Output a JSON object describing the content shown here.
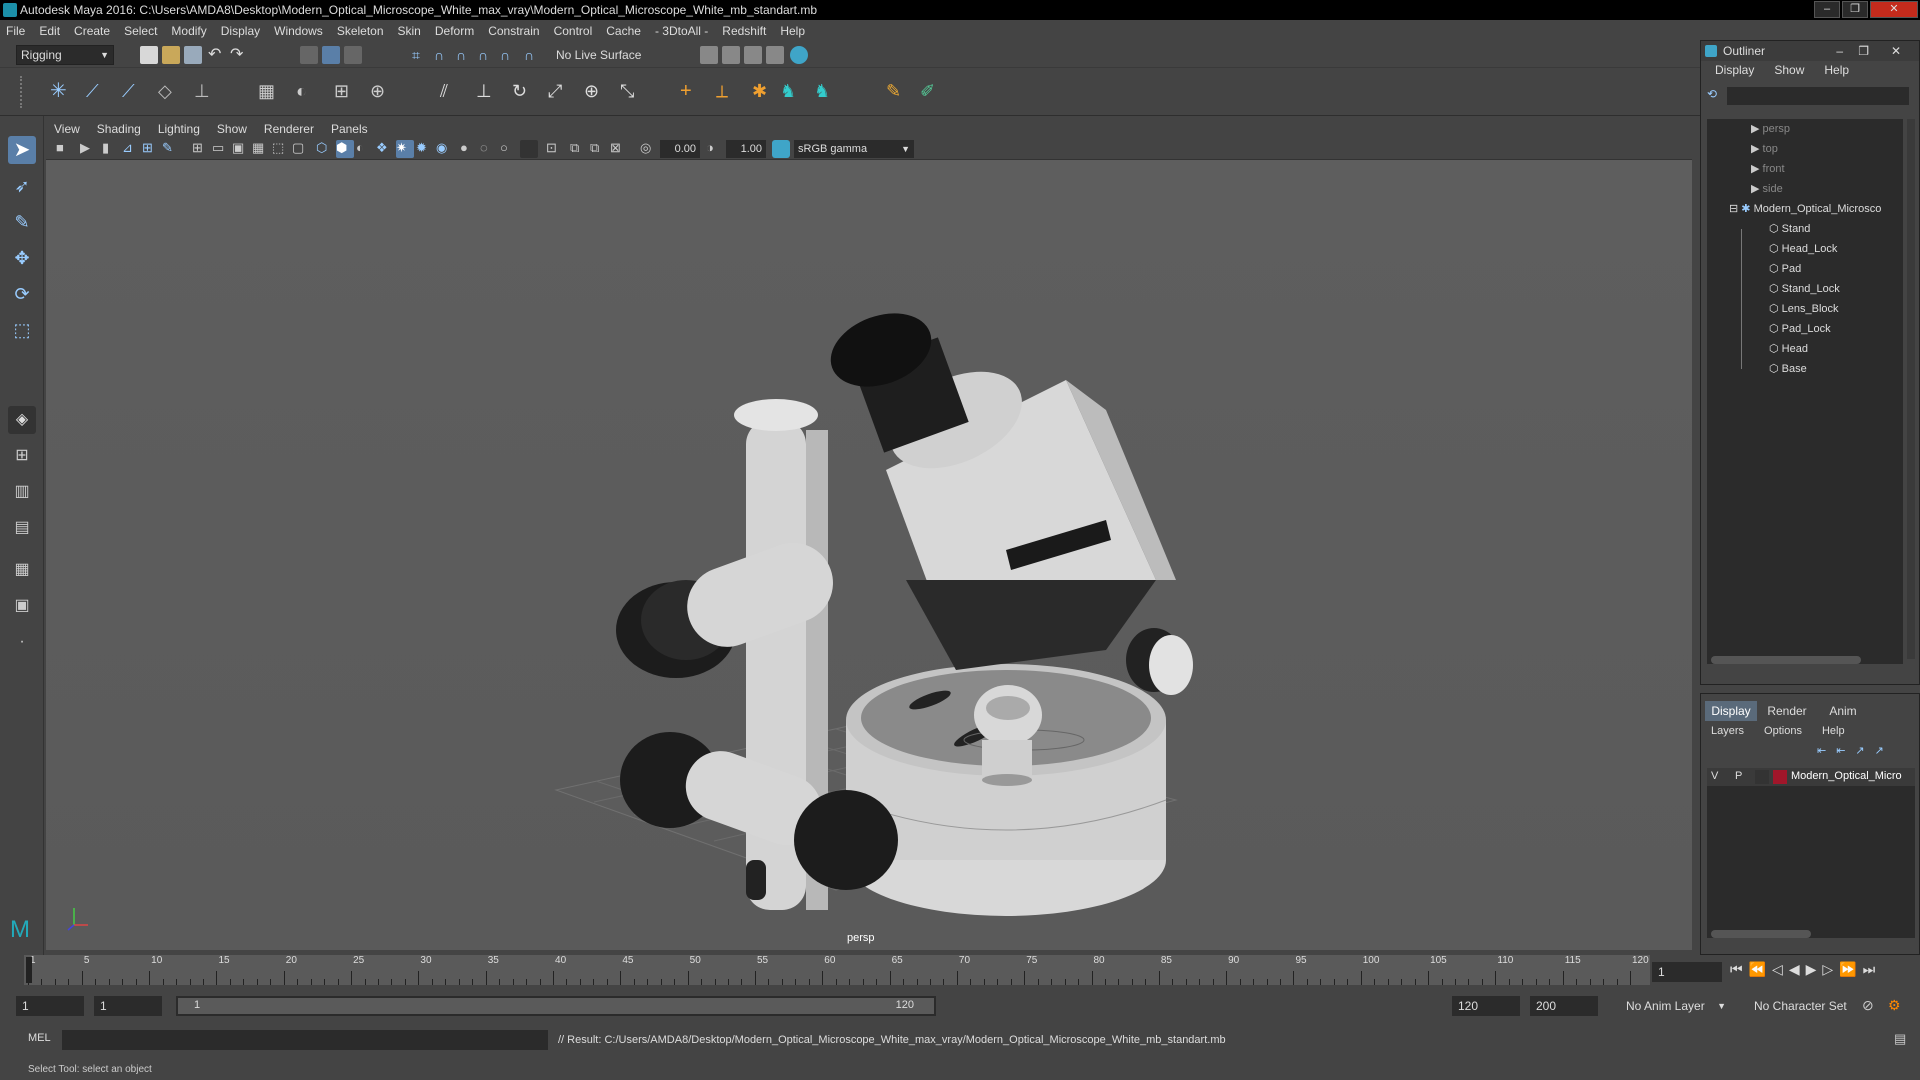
{
  "window": {
    "title": "Autodesk Maya 2016: C:\\Users\\AMDA8\\Desktop\\Modern_Optical_Microscope_White_max_vray\\Modern_Optical_Microscope_White_mb_standart.mb"
  },
  "menubar": [
    "File",
    "Edit",
    "Create",
    "Select",
    "Modify",
    "Display",
    "Windows",
    "Skeleton",
    "Skin",
    "Deform",
    "Constrain",
    "Control",
    "Cache",
    "- 3DtoAll -",
    "Redshift",
    "Help"
  ],
  "statusline": {
    "menuset": "Rigging",
    "live_surface": "No Live Surface"
  },
  "panel": {
    "menus": [
      "View",
      "Shading",
      "Lighting",
      "Show",
      "Renderer",
      "Panels"
    ],
    "exposure": "0.00",
    "gamma": "1.00",
    "color_space": "sRGB gamma",
    "camera_label": "persp"
  },
  "outliner": {
    "title": "Outliner",
    "menus": [
      "Display",
      "Show",
      "Help"
    ],
    "cameras": [
      "persp",
      "top",
      "front",
      "side"
    ],
    "group": "Modern_Optical_Microsco",
    "children": [
      "Stand",
      "Head_Lock",
      "Pad",
      "Stand_Lock",
      "Lens_Block",
      "Pad_Lock",
      "Head",
      "Base"
    ]
  },
  "layer_editor": {
    "tabs": [
      "Display",
      "Render",
      "Anim"
    ],
    "menus": [
      "Layers",
      "Options",
      "Help"
    ],
    "layer": {
      "v": "V",
      "p": "P",
      "name": "Modern_Optical_Micro",
      "color": "#a0162a"
    }
  },
  "timeline": {
    "ticks": [
      "1",
      "5",
      "10",
      "15",
      "20",
      "25",
      "30",
      "35",
      "40",
      "45",
      "50",
      "55",
      "60",
      "65",
      "70",
      "75",
      "80",
      "85",
      "90",
      "95",
      "100",
      "105",
      "110",
      "115",
      "120"
    ],
    "current_frame": "1",
    "range_start": "1",
    "playback_start": "1",
    "slider_start": "1",
    "slider_end": "120",
    "playback_end": "120",
    "range_end": "200",
    "anim_layer": "No Anim Layer",
    "character_set": "No Character Set"
  },
  "command": {
    "lang": "MEL",
    "result": "// Result: C:/Users/AMDA8/Desktop/Modern_Optical_Microscope_White_max_vray/Modern_Optical_Microscope_White_mb_standart.mb"
  },
  "helpline": "Select Tool: select an object"
}
